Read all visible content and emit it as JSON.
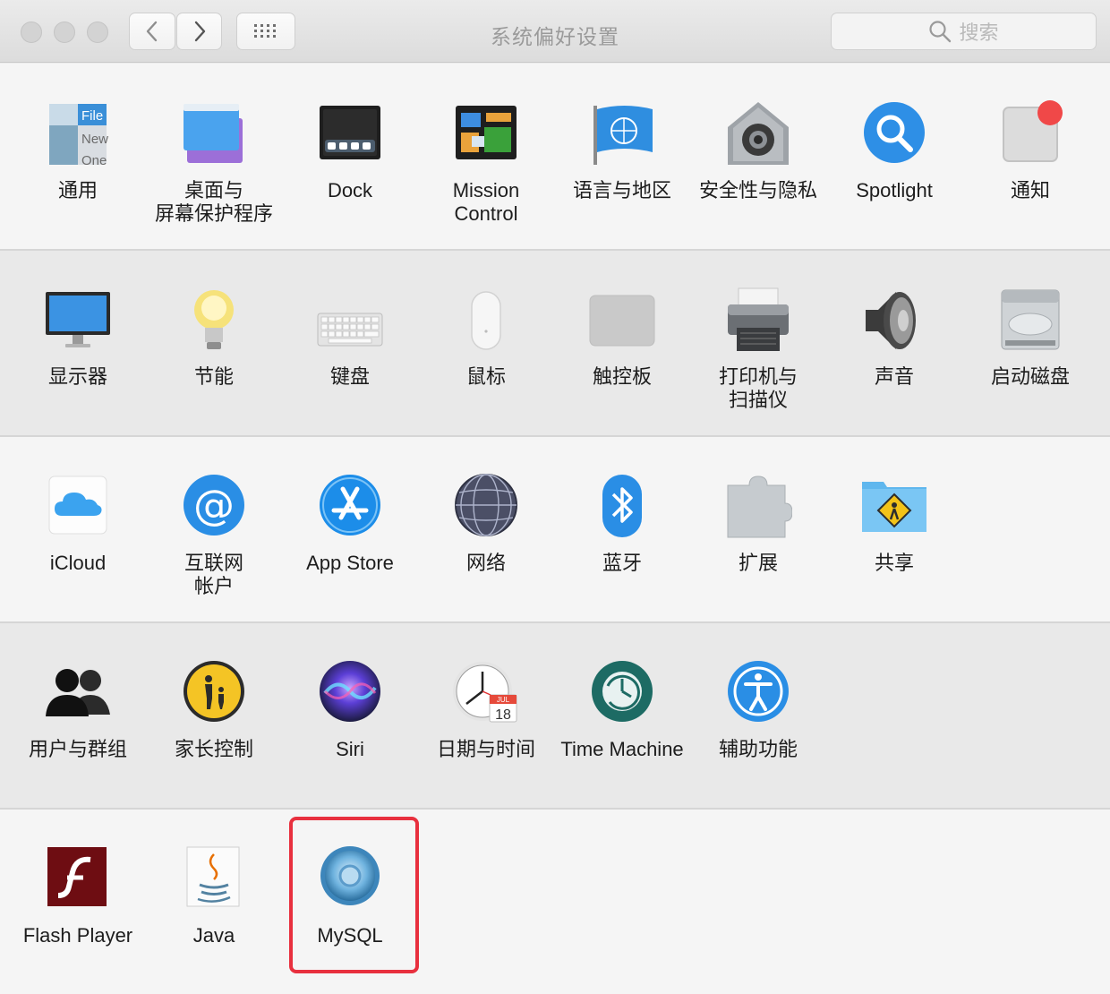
{
  "window": {
    "title": "系统偏好设置",
    "search": {
      "placeholder": "搜索"
    }
  },
  "toolbar": {
    "back_icon": "chevron-left-icon",
    "forward_icon": "chevron-right-icon",
    "show_all_icon": "grid-icon"
  },
  "highlight_color": "#e8303e",
  "rows": [
    {
      "items": [
        {
          "label": "通用",
          "icon": "general-icon"
        },
        {
          "label": "桌面与\n屏幕保护程序",
          "icon": "desktop-screensaver-icon"
        },
        {
          "label": "Dock",
          "icon": "dock-icon"
        },
        {
          "label": "Mission\nControl",
          "icon": "mission-control-icon"
        },
        {
          "label": "语言与地区",
          "icon": "language-region-icon"
        },
        {
          "label": "安全性与隐私",
          "icon": "security-privacy-icon"
        },
        {
          "label": "Spotlight",
          "icon": "spotlight-icon"
        },
        {
          "label": "通知",
          "icon": "notifications-icon"
        }
      ]
    },
    {
      "items": [
        {
          "label": "显示器",
          "icon": "displays-icon"
        },
        {
          "label": "节能",
          "icon": "energy-saver-icon"
        },
        {
          "label": "键盘",
          "icon": "keyboard-icon"
        },
        {
          "label": "鼠标",
          "icon": "mouse-icon"
        },
        {
          "label": "触控板",
          "icon": "trackpad-icon"
        },
        {
          "label": "打印机与\n扫描仪",
          "icon": "printers-scanners-icon"
        },
        {
          "label": "声音",
          "icon": "sound-icon"
        },
        {
          "label": "启动磁盘",
          "icon": "startup-disk-icon"
        }
      ]
    },
    {
      "items": [
        {
          "label": "iCloud",
          "icon": "icloud-icon"
        },
        {
          "label": "互联网\n帐户",
          "icon": "internet-accounts-icon"
        },
        {
          "label": "App Store",
          "icon": "app-store-icon"
        },
        {
          "label": "网络",
          "icon": "network-icon"
        },
        {
          "label": "蓝牙",
          "icon": "bluetooth-icon"
        },
        {
          "label": "扩展",
          "icon": "extensions-icon"
        },
        {
          "label": "共享",
          "icon": "sharing-icon"
        }
      ]
    },
    {
      "items": [
        {
          "label": "用户与群组",
          "icon": "users-groups-icon"
        },
        {
          "label": "家长控制",
          "icon": "parental-controls-icon"
        },
        {
          "label": "Siri",
          "icon": "siri-icon"
        },
        {
          "label": "日期与时间",
          "icon": "date-time-icon"
        },
        {
          "label": "Time Machine",
          "icon": "time-machine-icon"
        },
        {
          "label": "辅助功能",
          "icon": "accessibility-icon"
        }
      ]
    },
    {
      "items": [
        {
          "label": "Flash Player",
          "icon": "flash-player-icon"
        },
        {
          "label": "Java",
          "icon": "java-icon"
        },
        {
          "label": "MySQL",
          "icon": "mysql-icon"
        }
      ]
    }
  ],
  "icon_text": {
    "general": [
      "File",
      "New",
      "One"
    ],
    "calendar_month": "JUL",
    "calendar_day": "18"
  }
}
